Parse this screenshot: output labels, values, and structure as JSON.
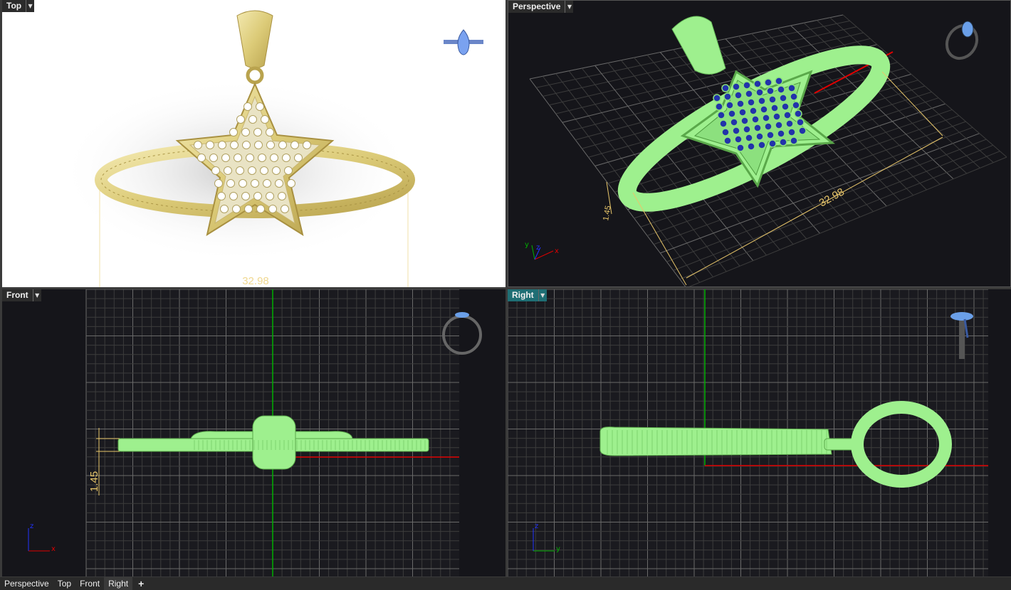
{
  "viewports": {
    "top": {
      "label": "Top",
      "dimension": "32.98"
    },
    "perspective": {
      "label": "Perspective",
      "dimension_width": "32.98",
      "dimension_height": "1.45"
    },
    "front": {
      "label": "Front",
      "dimension_height": "1.45"
    },
    "right": {
      "label": "Right"
    }
  },
  "axes": {
    "x": "x",
    "y": "y",
    "z": "z"
  },
  "bottom_tabs": [
    {
      "label": "Perspective"
    },
    {
      "label": "Top"
    },
    {
      "label": "Front"
    },
    {
      "label": "Right"
    }
  ],
  "add_tab_icon": "plus-icon",
  "colors": {
    "viewport_bg": "#15151a",
    "grid": "#5a5a5a",
    "model_green": "#9ef08e",
    "gold": "#e8d88a",
    "stones": "#2233aa",
    "dimension": "#e8c66a",
    "axis_x": "#e00000",
    "axis_y": "#00b000",
    "axis_z": "#2233ff",
    "active_tab": "#1f6e74"
  }
}
